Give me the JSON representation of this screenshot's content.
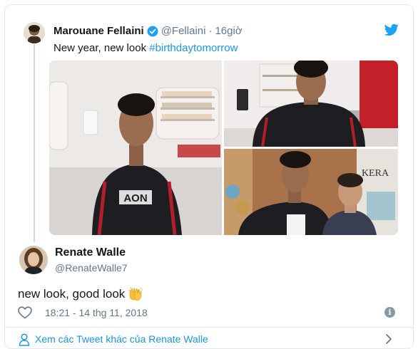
{
  "quoted_tweet": {
    "name": "Marouane Fellaini",
    "handle": "@Fellaini",
    "separator": "·",
    "time": "16giờ",
    "text_plain": "New year, new look ",
    "hashtag": "#birthdaytomorrow",
    "verified": true
  },
  "reply": {
    "name": "Renate Walle",
    "handle": "@RenateWalle7",
    "text": "new look, good look",
    "timestamp": "18:21 - 14 thg 11, 2018"
  },
  "footer": {
    "more_link": "Xem các Tweet khác của Renate Walle"
  },
  "icons": {
    "twitter": "twitter-bird-icon",
    "verified": "verified-badge-icon",
    "like": "heart-icon",
    "info": "info-icon",
    "person": "person-icon",
    "chevron": "chevron-right-icon",
    "emoji": "raising-hands-emoji"
  },
  "colors": {
    "link": "#1b95e0",
    "secondary_text": "#657786",
    "border": "#e1e8ed",
    "twitter_blue": "#1da1f2"
  }
}
